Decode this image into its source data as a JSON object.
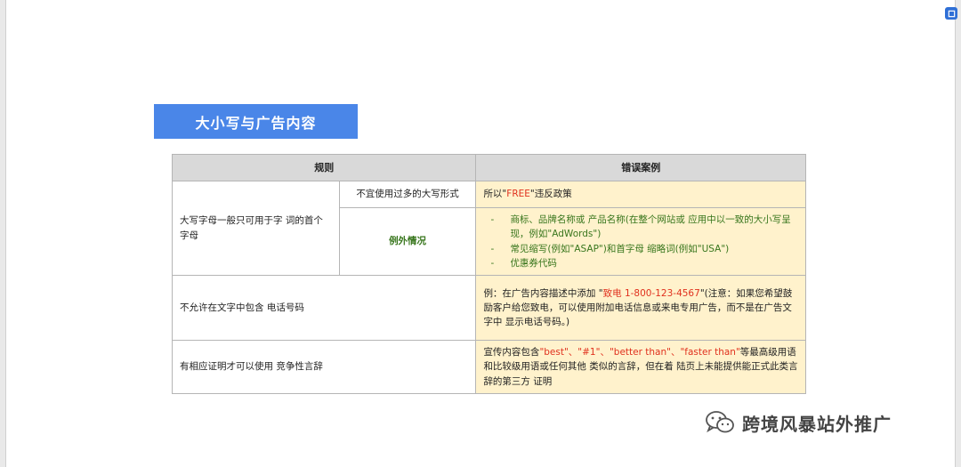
{
  "title": "大小写与广告内容",
  "table": {
    "header_rule": "规则",
    "header_example": "错误案例",
    "row1": {
      "rule": "大写字母一般只可用于字 词的首个字母",
      "sub1": "不宜使用过多的大写形式",
      "ex1_prefix": "所以\"",
      "ex1_red": "FREE",
      "ex1_suffix": "\"违反政策",
      "sub2": "例外情况",
      "exceptions": [
        "商标、品牌名称或 产品名称(在整个网站或 应用中以一致的大小写呈现，例如\"AdWords\")",
        "常见缩写(例如\"ASAP\")和首字母 缩略词(例如\"USA\")",
        "优惠券代码"
      ]
    },
    "row2": {
      "rule": "不允许在文字中包含 电话号码",
      "ex_prefix": "例：在广告内容描述中添加 \"",
      "ex_red": "致电 1-800-123-4567",
      "ex_suffix": "\"(注意：如果您希望鼓励客户给您致电，可以使用附加电话信息或来电专用广告，而不是在广告文字中 显示电话号码。)"
    },
    "row3": {
      "rule": "有相应证明才可以使用 竞争性言辞",
      "ex_prefix": "宣传内容包含",
      "ex_red": "\"best\"、\"#1\"、\"better than\"、\"faster than\"",
      "ex_suffix": "等最高级用语和比较级用语或任何其他 类似的言辞，但在着 陆页上未能提供能正式此类言辞的第三方 证明"
    }
  },
  "watermark": "跨境风暴站外推广",
  "colors": {
    "title_bg": "#4a86e8",
    "header_bg": "#d9d9d9",
    "example_bg": "#fff2cc",
    "red": "#e0311e",
    "green": "#38761d"
  },
  "icons": {
    "corner": "expand-icon",
    "watermark": "wechat-icon"
  }
}
